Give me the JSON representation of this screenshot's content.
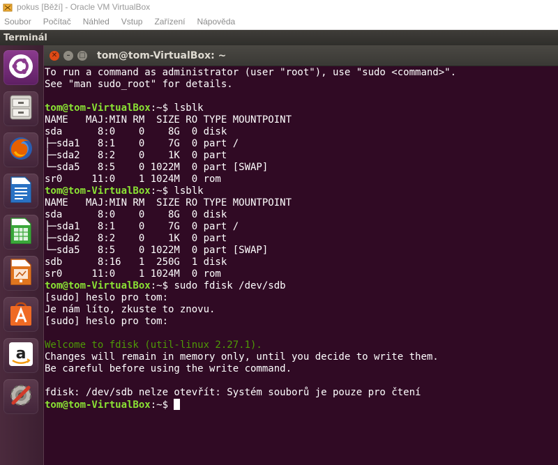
{
  "vbox": {
    "title": "pokus [Běží] - Oracle VM VirtualBox",
    "menu": [
      "Soubor",
      "Počítač",
      "Náhled",
      "Vstup",
      "Zařízení",
      "Nápověda"
    ]
  },
  "topbar": {
    "title": "Terminál"
  },
  "launcher": {
    "items": [
      "ubuntu-dash",
      "files",
      "firefox",
      "writer",
      "calc",
      "impress",
      "software-center",
      "amazon",
      "system-settings"
    ]
  },
  "terminal": {
    "title": "tom@tom-VirtualBox: ~",
    "prompt": "tom@tom-VirtualBox",
    "lines": [
      {
        "t": "To run a command as administrator (user \"root\"), use \"sudo <command>\"."
      },
      {
        "t": "See \"man sudo_root\" for details."
      },
      {
        "t": ""
      },
      {
        "p": "tom@tom-VirtualBox",
        "s": ":~$ ",
        "c": "lsblk"
      },
      {
        "t": "NAME   MAJ:MIN RM  SIZE RO TYPE MOUNTPOINT"
      },
      {
        "t": "sda      8:0    0    8G  0 disk"
      },
      {
        "t": "├─sda1   8:1    0    7G  0 part /"
      },
      {
        "t": "├─sda2   8:2    0    1K  0 part"
      },
      {
        "t": "└─sda5   8:5    0 1022M  0 part [SWAP]"
      },
      {
        "t": "sr0     11:0    1 1024M  0 rom"
      },
      {
        "p": "tom@tom-VirtualBox",
        "s": ":~$ ",
        "c": "lsblk"
      },
      {
        "t": "NAME   MAJ:MIN RM  SIZE RO TYPE MOUNTPOINT"
      },
      {
        "t": "sda      8:0    0    8G  0 disk"
      },
      {
        "t": "├─sda1   8:1    0    7G  0 part /"
      },
      {
        "t": "├─sda2   8:2    0    1K  0 part"
      },
      {
        "t": "└─sda5   8:5    0 1022M  0 part [SWAP]"
      },
      {
        "t": "sdb      8:16   1  250G  1 disk"
      },
      {
        "t": "sr0     11:0    1 1024M  0 rom"
      },
      {
        "p": "tom@tom-VirtualBox",
        "s": ":~$ ",
        "c": "sudo fdisk /dev/sdb"
      },
      {
        "t": "[sudo] heslo pro tom:"
      },
      {
        "t": "Je nám líto, zkuste to znovu."
      },
      {
        "t": "[sudo] heslo pro tom:"
      },
      {
        "t": ""
      },
      {
        "g": "Welcome to fdisk (util-linux 2.27.1)."
      },
      {
        "t": "Changes will remain in memory only, until you decide to write them."
      },
      {
        "t": "Be careful before using the write command."
      },
      {
        "t": ""
      },
      {
        "t": "fdisk: /dev/sdb nelze otevřít: Systém souborů je pouze pro čtení"
      },
      {
        "p": "tom@tom-VirtualBox",
        "s": ":~$ ",
        "c": "",
        "cursor": true
      }
    ]
  },
  "colors": {
    "terminal_bg": "#300a24",
    "prompt": "#8ae234",
    "fdisk_welcome": "#4e9a06",
    "close_button": "#df4a16"
  }
}
